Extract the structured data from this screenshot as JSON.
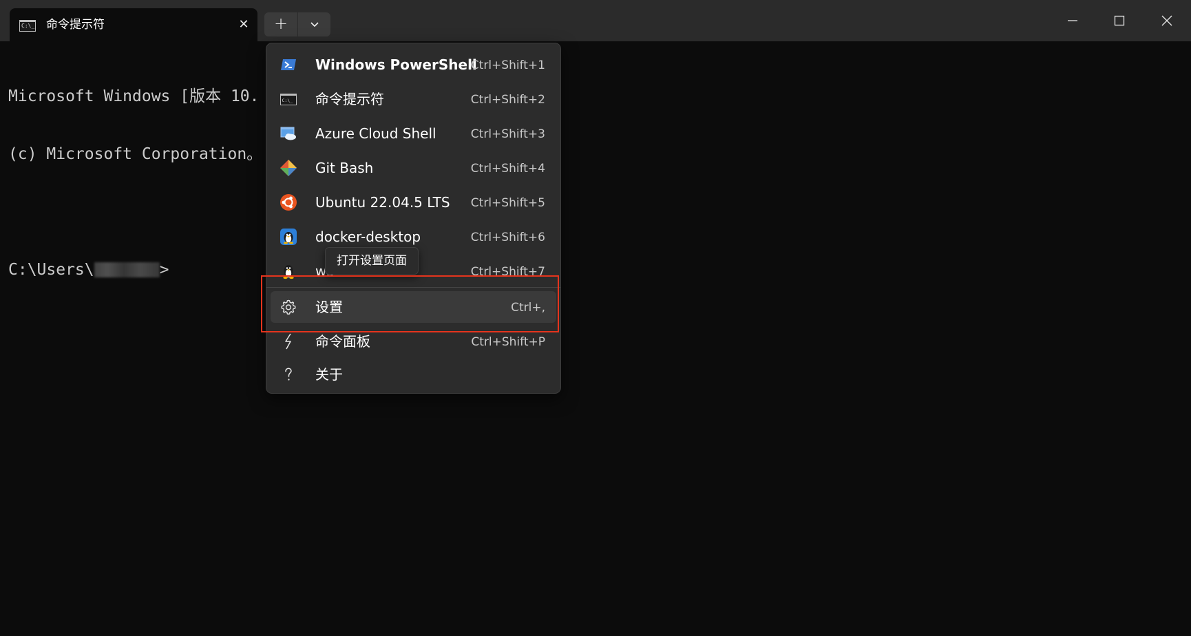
{
  "tab": {
    "icon_text": "C:\\_",
    "title": "命令提示符",
    "close_glyph": "✕"
  },
  "toolbar": {
    "new_tab_glyph": "+"
  },
  "terminal": {
    "lines": [
      "Microsoft Windows [版本 10.",
      "(c) Microsoft Corporation。",
      "",
      "C:\\Users\\"
    ],
    "prompt_suffix": ">"
  },
  "menu": {
    "items": [
      {
        "icon": "powershell-icon",
        "label": "Windows PowerShell",
        "shortcut": "Ctrl+Shift+1"
      },
      {
        "icon": "cmd-icon",
        "label": "命令提示符",
        "shortcut": "Ctrl+Shift+2"
      },
      {
        "icon": "azure-cloud-icon",
        "label": "Azure Cloud Shell",
        "shortcut": "Ctrl+Shift+3"
      },
      {
        "icon": "git-icon",
        "label": "Git Bash",
        "shortcut": "Ctrl+Shift+4"
      },
      {
        "icon": "ubuntu-icon",
        "label": "Ubuntu 22.04.5 LTS",
        "shortcut": "Ctrl+Shift+5"
      },
      {
        "icon": "tux-icon",
        "label": "docker-desktop",
        "shortcut": "Ctrl+Shift+6"
      },
      {
        "icon": "tux-icon",
        "label": "ws",
        "shortcut": "Ctrl+Shift+7"
      },
      {
        "icon": "gear-icon",
        "label": "设置",
        "shortcut": "Ctrl+,"
      },
      {
        "icon": "lightning-icon",
        "label": "命令面板",
        "shortcut": "Ctrl+Shift+P"
      },
      {
        "icon": "question-icon",
        "label": "关于",
        "shortcut": ""
      }
    ]
  },
  "tooltip": {
    "text": "打开设置页面"
  },
  "colors": {
    "highlight": "#e5341d",
    "menu_bg": "#2c2c2c",
    "titlebar_bg": "#2b2b2b",
    "terminal_bg": "#0c0c0c"
  }
}
